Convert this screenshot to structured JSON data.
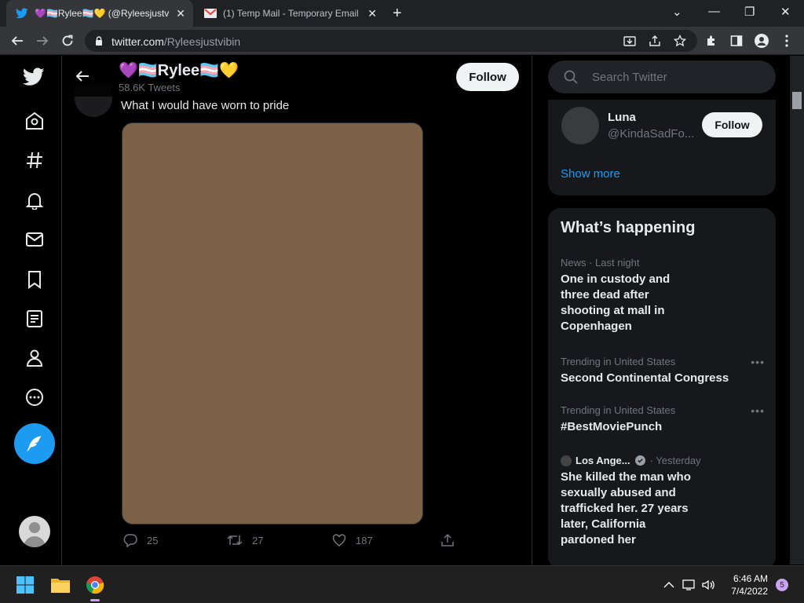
{
  "browser": {
    "tabs": [
      {
        "title": "💜🏳️‍⚧️Rylee🏳️‍⚧️💛 (@Ryleesjustvibin)",
        "icon": "twitter-bird-icon"
      },
      {
        "title": "(1) Temp Mail - Temporary Email",
        "icon": "gmail-icon"
      }
    ],
    "url_host": "twitter.com",
    "url_path": "/Ryleesjustvibin"
  },
  "profile": {
    "name": "💜🏳️‍⚧️Rylee🏳️‍⚧️💛",
    "tweet_count": "58.6K Tweets",
    "follow_label": "Follow"
  },
  "tweet": {
    "text": "What I would have worn to pride",
    "media_color": "#7d6147",
    "replies": "25",
    "retweets": "27",
    "likes": "187"
  },
  "search": {
    "placeholder": "Search Twitter"
  },
  "who_to_follow": {
    "name": "Luna",
    "handle": "@KindaSadFo...",
    "follow_label": "Follow",
    "show_more": "Show more"
  },
  "whats_happening": {
    "title": "What’s happening",
    "items": [
      {
        "meta": "News · Last night",
        "headline": "One in custody and three dead after shooting at mall in Copenhagen"
      },
      {
        "meta": "Trending in United States",
        "headline": "Second Continental Congress"
      },
      {
        "meta": "Trending in United States",
        "headline": "#BestMoviePunch"
      },
      {
        "source": "Los Ange...",
        "meta": "· Yesterday",
        "headline": "She killed the man who sexually abused and trafficked her. 27 years later, California pardoned her"
      }
    ]
  },
  "taskbar": {
    "time": "6:46 AM",
    "date": "7/4/2022",
    "notifications": "5"
  },
  "colors": {
    "accent": "#1d9bf0",
    "background": "#000000"
  }
}
